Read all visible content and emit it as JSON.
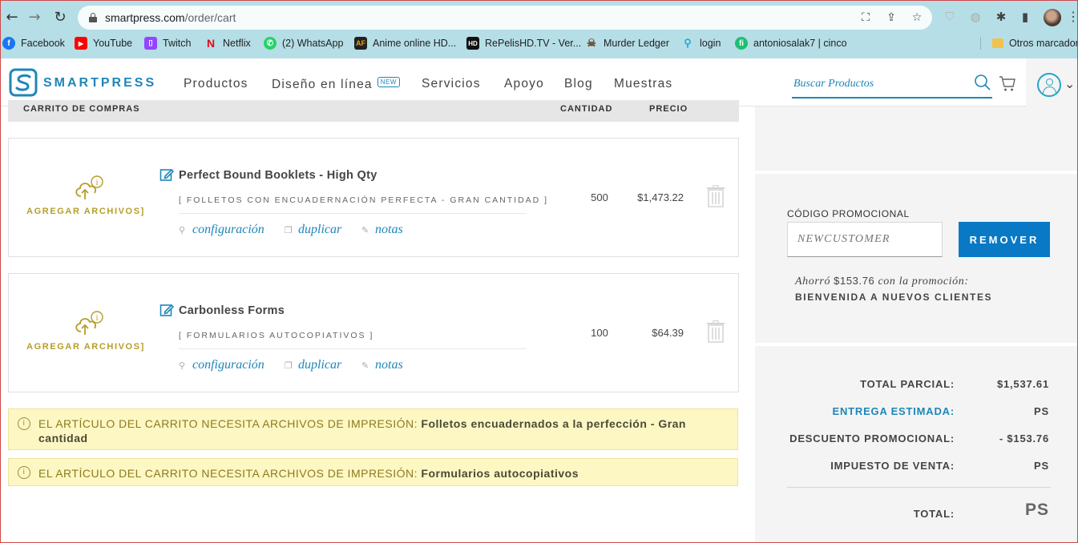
{
  "browser": {
    "url_domain": "smartpress.com",
    "url_path": "/order/cart",
    "bookmarks": [
      {
        "label": "Facebook",
        "icon": "facebook-icon",
        "color": "#1877f2"
      },
      {
        "label": "YouTube",
        "icon": "youtube-icon",
        "color": "#ff0000"
      },
      {
        "label": "Twitch",
        "icon": "twitch-icon",
        "color": "#9146ff"
      },
      {
        "label": "Netflix",
        "icon": "netflix-icon",
        "color": "#e50914"
      },
      {
        "label": "(2) WhatsApp",
        "icon": "whatsapp-icon",
        "color": "#25d366"
      },
      {
        "label": "Anime online HD...",
        "icon": "animeflv-icon",
        "color": "#222222"
      },
      {
        "label": "RePelisHD.TV - Ver...",
        "icon": "hd-icon",
        "color": "#111111"
      },
      {
        "label": "Murder Ledger",
        "icon": "pirate-icon",
        "color": "#6b4a2b"
      },
      {
        "label": "login",
        "icon": "login-icon",
        "color": "#2aa7d8"
      },
      {
        "label": "antoniosalak7 | cinco",
        "icon": "fiverr-icon",
        "color": "#1dbf73"
      },
      {
        "label": "Otros marcadores",
        "icon": "folder-icon",
        "color": "#f2c14e"
      }
    ]
  },
  "header": {
    "brand": "SMARTPRESS",
    "nav": [
      {
        "label": "Productos"
      },
      {
        "label": "Diseño en línea",
        "badge": "NEW"
      },
      {
        "label": "Servicios"
      },
      {
        "label": "Apoyo"
      },
      {
        "label": "Blog"
      },
      {
        "label": "Muestras"
      }
    ],
    "search_placeholder": "Buscar Productos"
  },
  "cart": {
    "columns": {
      "item": "CARRITO DE COMPRAS",
      "qty": "CANTIDAD",
      "price": "PRECIO"
    },
    "upload_label": "AGREGAR ARCHIVOS]",
    "actions": {
      "config": "configuración",
      "duplicate": "duplicar",
      "notes": "notas"
    },
    "items": [
      {
        "name": "Perfect Bound Booklets - High Qty",
        "subtitle": "[ FOLLETOS CON ENCUADERNACIÓN PERFECTA - GRAN CANTIDAD ]",
        "qty": "500",
        "price": "$1,473.22"
      },
      {
        "name": "Carbonless Forms",
        "subtitle": "[ FORMULARIOS AUTOCOPIATIVOS ]",
        "qty": "100",
        "price": "$64.39"
      }
    ],
    "notices": [
      {
        "prefix": "EL ARTÍCULO DEL CARRITO NECESITA ARCHIVOS DE IMPRESIÓN:",
        "item": "Folletos encuadernados a la perfección - Gran cantidad"
      },
      {
        "prefix": "EL ARTÍCULO DEL CARRITO NECESITA ARCHIVOS DE IMPRESIÓN:",
        "item": "Formularios autocopiativos"
      }
    ]
  },
  "summary": {
    "promo_label": "CÓDIGO PROMOCIONAL",
    "promo_code": "NEWCUSTOMER",
    "remove_button": "REMOVER",
    "saved_prefix": "Ahorró",
    "saved_amount": "$153.76",
    "saved_suffix": "con la promoción:",
    "promo_name": "BIENVENIDA A NUEVOS CLIENTES",
    "rows": [
      {
        "label": "TOTAL PARCIAL:",
        "value": "$1,537.61"
      },
      {
        "label": "ENTREGA ESTIMADA:",
        "value": "PS"
      },
      {
        "label": "DESCUENTO PROMOCIONAL:",
        "value": "- $153.76"
      },
      {
        "label": "IMPUESTO DE VENTA:",
        "value": "PS"
      }
    ],
    "total_label": "TOTAL:",
    "total_value": "PS"
  },
  "colors": {
    "accent": "#1e86b9",
    "button": "#0979c5",
    "upload_gold": "#b59e2a",
    "notice_bg": "#fdf7c4"
  }
}
